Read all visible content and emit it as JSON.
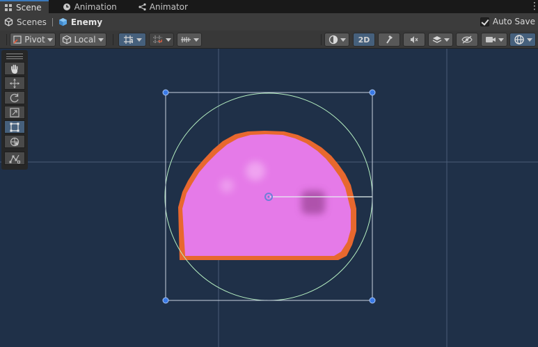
{
  "tabs": [
    {
      "label": "Scene",
      "icon": "scene-grid-icon",
      "active": true
    },
    {
      "label": "Animation",
      "icon": "clock-icon",
      "active": false
    },
    {
      "label": "Animator",
      "icon": "node-graph-icon",
      "active": false
    }
  ],
  "breadcrumb": {
    "root": "Scenes",
    "current": "Enemy"
  },
  "autosave": {
    "label": "Auto Save",
    "checked": true
  },
  "toolbar": {
    "pivot_label": "Pivot",
    "local_label": "Local",
    "two_d_label": "2D"
  },
  "tools": [
    {
      "name": "hand-tool",
      "icon": "hand-icon",
      "active": false
    },
    {
      "name": "move-tool",
      "icon": "move-arrows-icon",
      "active": false
    },
    {
      "name": "rotate-tool",
      "icon": "rotate-icon",
      "active": false
    },
    {
      "name": "scale-tool",
      "icon": "scale-icon",
      "active": false
    },
    {
      "name": "rect-tool",
      "icon": "rect-transform-icon",
      "active": true
    },
    {
      "name": "transform-tool",
      "icon": "transform-icon",
      "active": false
    },
    {
      "name": "custom-tool",
      "icon": "custom-editor-tool-icon",
      "active": false
    }
  ],
  "colors": {
    "scene_bg": "#1f3048",
    "slime_fill": "#e57ae8",
    "slime_outline": "#e8602a",
    "collider_circle": "#b6f0c2",
    "handle_blue": "#2f6fe0",
    "accent_active": "#46607c"
  }
}
